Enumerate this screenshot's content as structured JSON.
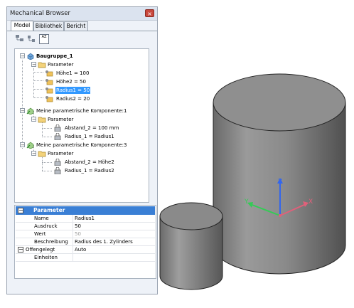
{
  "panel": {
    "title": "Mechanical Browser",
    "close_symbol": "×",
    "tabs": [
      {
        "label": "Model",
        "active": true
      },
      {
        "label": "Bibliothek",
        "active": false
      },
      {
        "label": "Bericht",
        "active": false
      }
    ],
    "toolbar_icons": [
      "tree-view-icon",
      "component-view-icon",
      "sort-az-icon"
    ],
    "sort_icon_text": "AZ"
  },
  "tree": {
    "root": "Baugruppe_1",
    "parameter_label": "Parameter",
    "parameters": [
      "Höhe1 = 100",
      "Höhe2 = 50",
      "Radius1 = 50",
      "Radius2 = 20"
    ],
    "components": [
      {
        "label": "Meine parametrische Komponente:1",
        "parameter_label": "Parameter",
        "params": [
          "Abstand_2 = 100 mm",
          "Radius_1 = Radius1"
        ]
      },
      {
        "label": "Meine parametrische Komponente:3",
        "parameter_label": "Parameter",
        "params": [
          "Abstand_2 = Höhe2",
          "Radius_1 = Radius2"
        ]
      }
    ],
    "expand_symbol": "−"
  },
  "properties": {
    "header": "Parameter",
    "rows": [
      {
        "key": "Name",
        "value": "Radius1"
      },
      {
        "key": "Ausdruck",
        "value": "50"
      },
      {
        "key": "Wert",
        "value": "50"
      },
      {
        "key": "Beschreibung",
        "value": "Radius des 1. Zylinders"
      },
      {
        "key": "Offengelegt",
        "value": "Auto"
      },
      {
        "key": "Einheiten",
        "value": ""
      }
    ]
  },
  "viewport": {
    "axes": {
      "x": "X",
      "y": "Y",
      "z": "Z"
    },
    "colors": {
      "x": "#e0607a",
      "y": "#33cc55",
      "z": "#3366ee",
      "cylinder": "#8c8c8c"
    }
  }
}
